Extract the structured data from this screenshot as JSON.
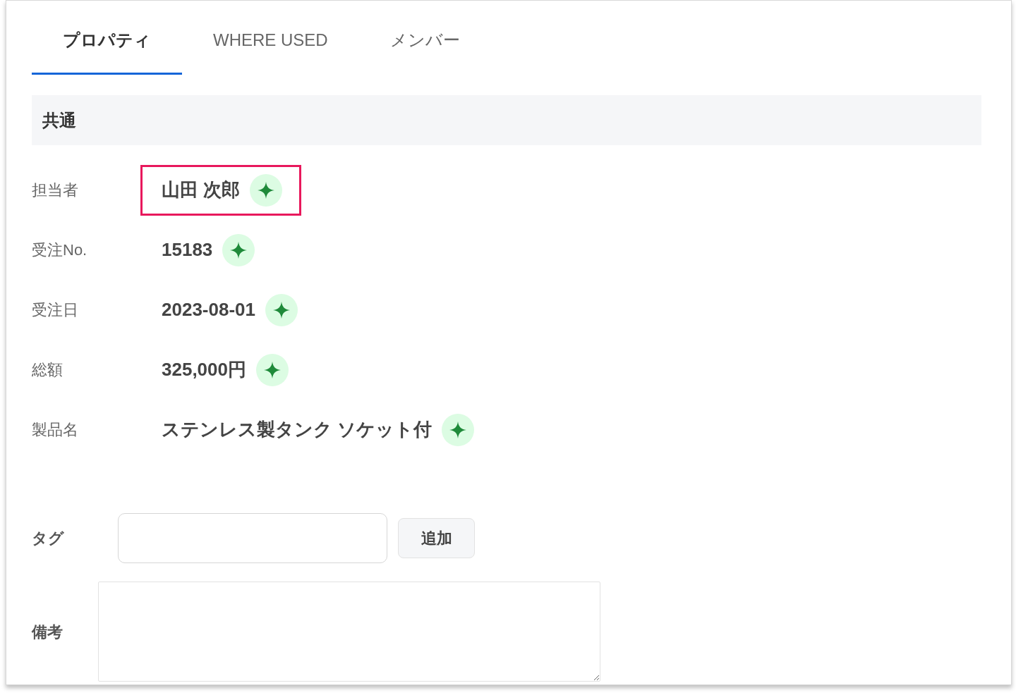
{
  "tabs": [
    {
      "label": "プロパティ",
      "selected": true
    },
    {
      "label": "WHERE USED",
      "selected": false
    },
    {
      "label": "メンバー",
      "selected": false
    }
  ],
  "section": {
    "title": "共通"
  },
  "fields": [
    {
      "label": "担当者",
      "value": "山田 次郎",
      "highlighted": true
    },
    {
      "label": "受注No.",
      "value": "15183",
      "highlighted": false
    },
    {
      "label": "受注日",
      "value": "2023-08-01",
      "highlighted": false
    },
    {
      "label": "総額",
      "value": "325,000円",
      "highlighted": false
    },
    {
      "label": "製品名",
      "value": "ステンレス製タンク ソケット付",
      "highlighted": false
    }
  ],
  "tag": {
    "label": "タグ",
    "button": "追加"
  },
  "remarks": {
    "label": "備考"
  }
}
